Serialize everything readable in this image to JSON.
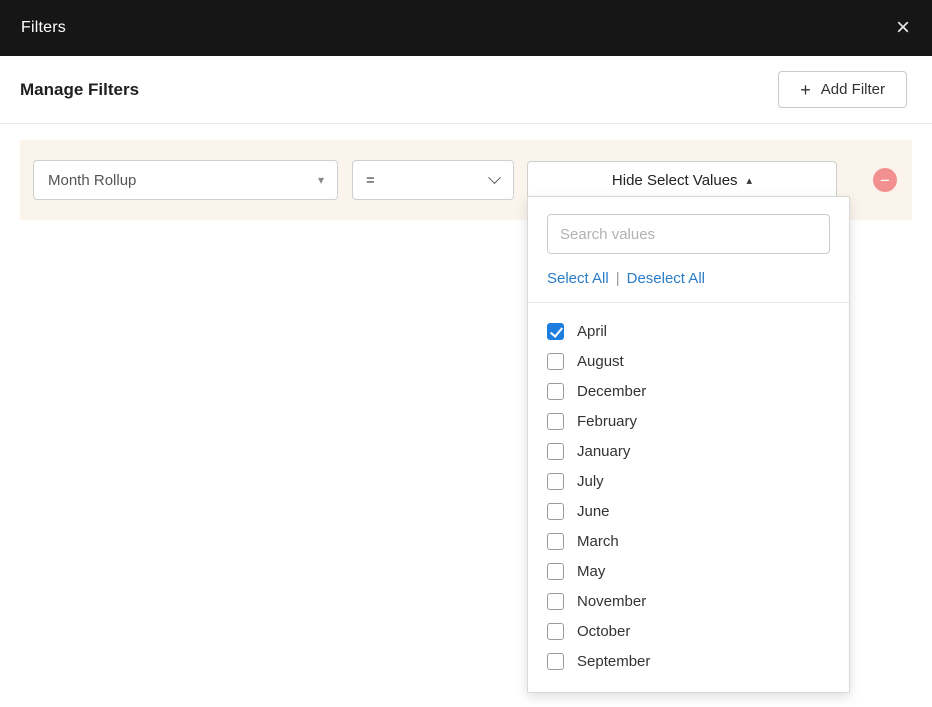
{
  "modal": {
    "title": "Filters",
    "close_icon": "×"
  },
  "header": {
    "title": "Manage Filters",
    "add_filter": {
      "icon": "+",
      "label": "Add Filter"
    }
  },
  "filter_row": {
    "column_select": {
      "value": "Month Rollup",
      "caret": "▾"
    },
    "operator_select": {
      "value": "="
    },
    "values_button": {
      "label": "Hide Select Values",
      "caret": "▴"
    },
    "remove_icon": "−"
  },
  "values_dropdown": {
    "search_placeholder": "Search values",
    "select_all_label": "Select All",
    "separator": "|",
    "deselect_all_label": "Deselect All",
    "items": [
      {
        "label": "April",
        "checked": true
      },
      {
        "label": "August",
        "checked": false
      },
      {
        "label": "December",
        "checked": false
      },
      {
        "label": "February",
        "checked": false
      },
      {
        "label": "January",
        "checked": false
      },
      {
        "label": "July",
        "checked": false
      },
      {
        "label": "June",
        "checked": false
      },
      {
        "label": "March",
        "checked": false
      },
      {
        "label": "May",
        "checked": false
      },
      {
        "label": "November",
        "checked": false
      },
      {
        "label": "October",
        "checked": false
      },
      {
        "label": "September",
        "checked": false
      }
    ]
  },
  "colors": {
    "header_bg": "#161616",
    "filter_row_bg": "#faf4ec",
    "link_blue": "#2a7cc7",
    "checkbox_checked": "#1e7ee0",
    "remove_pink": "#f29090"
  }
}
